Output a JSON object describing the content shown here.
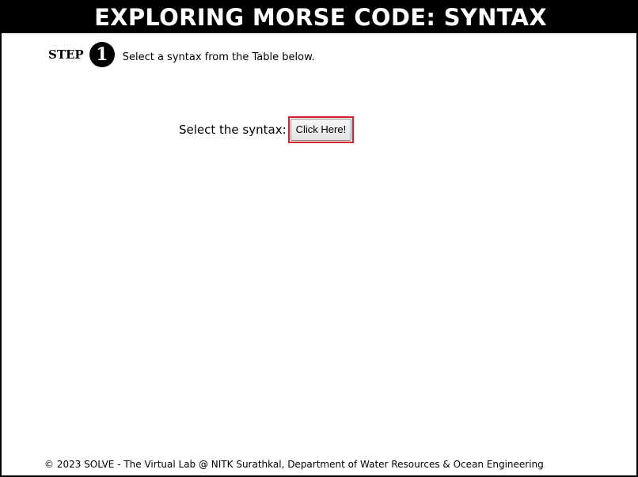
{
  "header": {
    "title": "EXPLORING MORSE CODE: SYNTAX"
  },
  "step": {
    "label": "STEP",
    "number": "1",
    "instruction": "Select a syntax from the Table below."
  },
  "syntax": {
    "label": "Select the syntax:",
    "button_label": "Click Here!"
  },
  "footer": {
    "text": "© 2023 SOLVE - The Virtual Lab @ NITK Surathkal, Department of Water Resources & Ocean Engineering"
  },
  "colors": {
    "header_bg": "#000000",
    "header_text": "#ffffff",
    "button_highlight": "#d0232a"
  }
}
